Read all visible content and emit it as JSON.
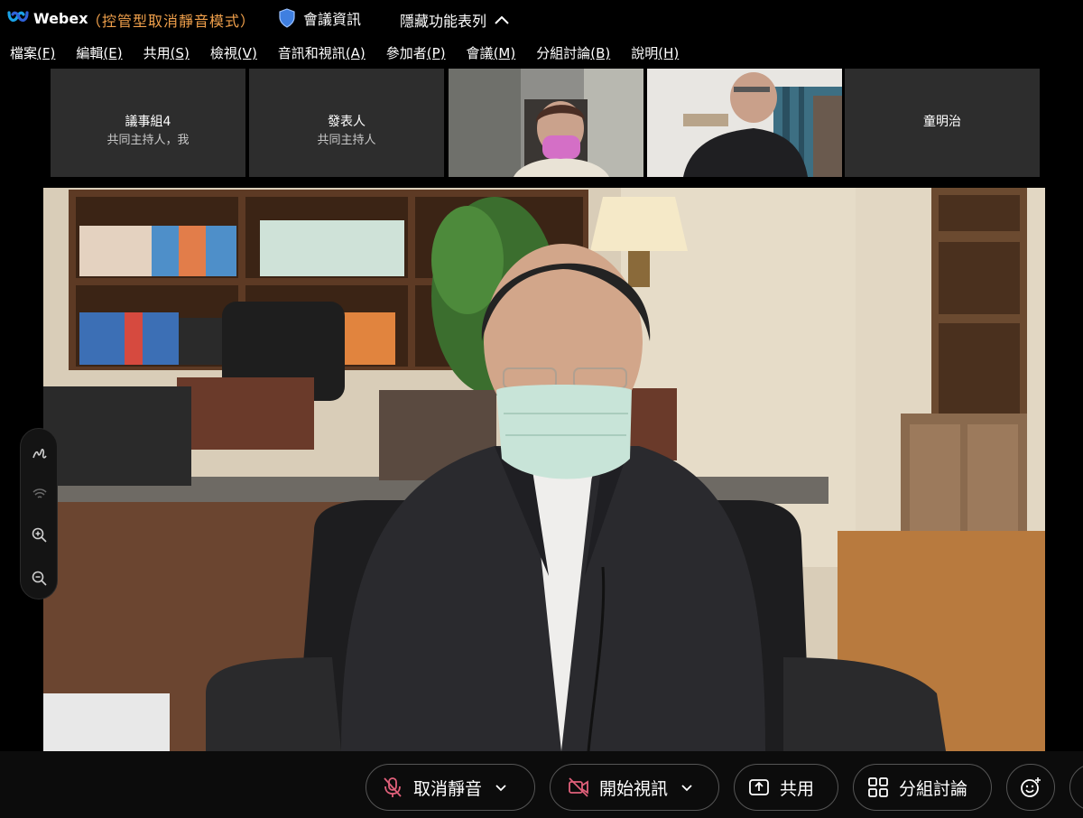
{
  "titlebar": {
    "app_name": "Webex",
    "mode_label": "（控管型取消靜音模式）",
    "meeting_info_label": "會議資訊",
    "hide_menu_label": "隱藏功能表列"
  },
  "menubar": [
    {
      "label": "檔案",
      "key": "(F)"
    },
    {
      "label": "編輯",
      "key": "(E)"
    },
    {
      "label": "共用",
      "key": "(S)"
    },
    {
      "label": "檢視",
      "key": "(V)"
    },
    {
      "label": "音訊和視訊",
      "key": "(A)"
    },
    {
      "label": "參加者",
      "key": "(P)"
    },
    {
      "label": "會議",
      "key": "(M)"
    },
    {
      "label": "分組討論",
      "key": "(B)"
    },
    {
      "label": "說明",
      "key": "(H)"
    }
  ],
  "thumbnails": [
    {
      "name": "議事組4",
      "subtitle": "共同主持人，我"
    },
    {
      "name": "發表人",
      "subtitle": "共同主持人"
    },
    {
      "name": "",
      "subtitle": ""
    },
    {
      "name": "",
      "subtitle": ""
    },
    {
      "name": "童明治",
      "subtitle": ""
    }
  ],
  "side_tools": [
    "annotate-icon",
    "audio-wave-icon",
    "zoom-in-icon",
    "zoom-out-icon"
  ],
  "controls": {
    "unmute_label": "取消靜音",
    "start_video_label": "開始視訊",
    "share_label": "共用",
    "breakout_label": "分組討論"
  },
  "colors": {
    "mode_text": "#f0a04b",
    "thumb_bg": "#2d2d2d",
    "unmute_icon": "#e0607a",
    "video_icon": "#e0607a"
  }
}
